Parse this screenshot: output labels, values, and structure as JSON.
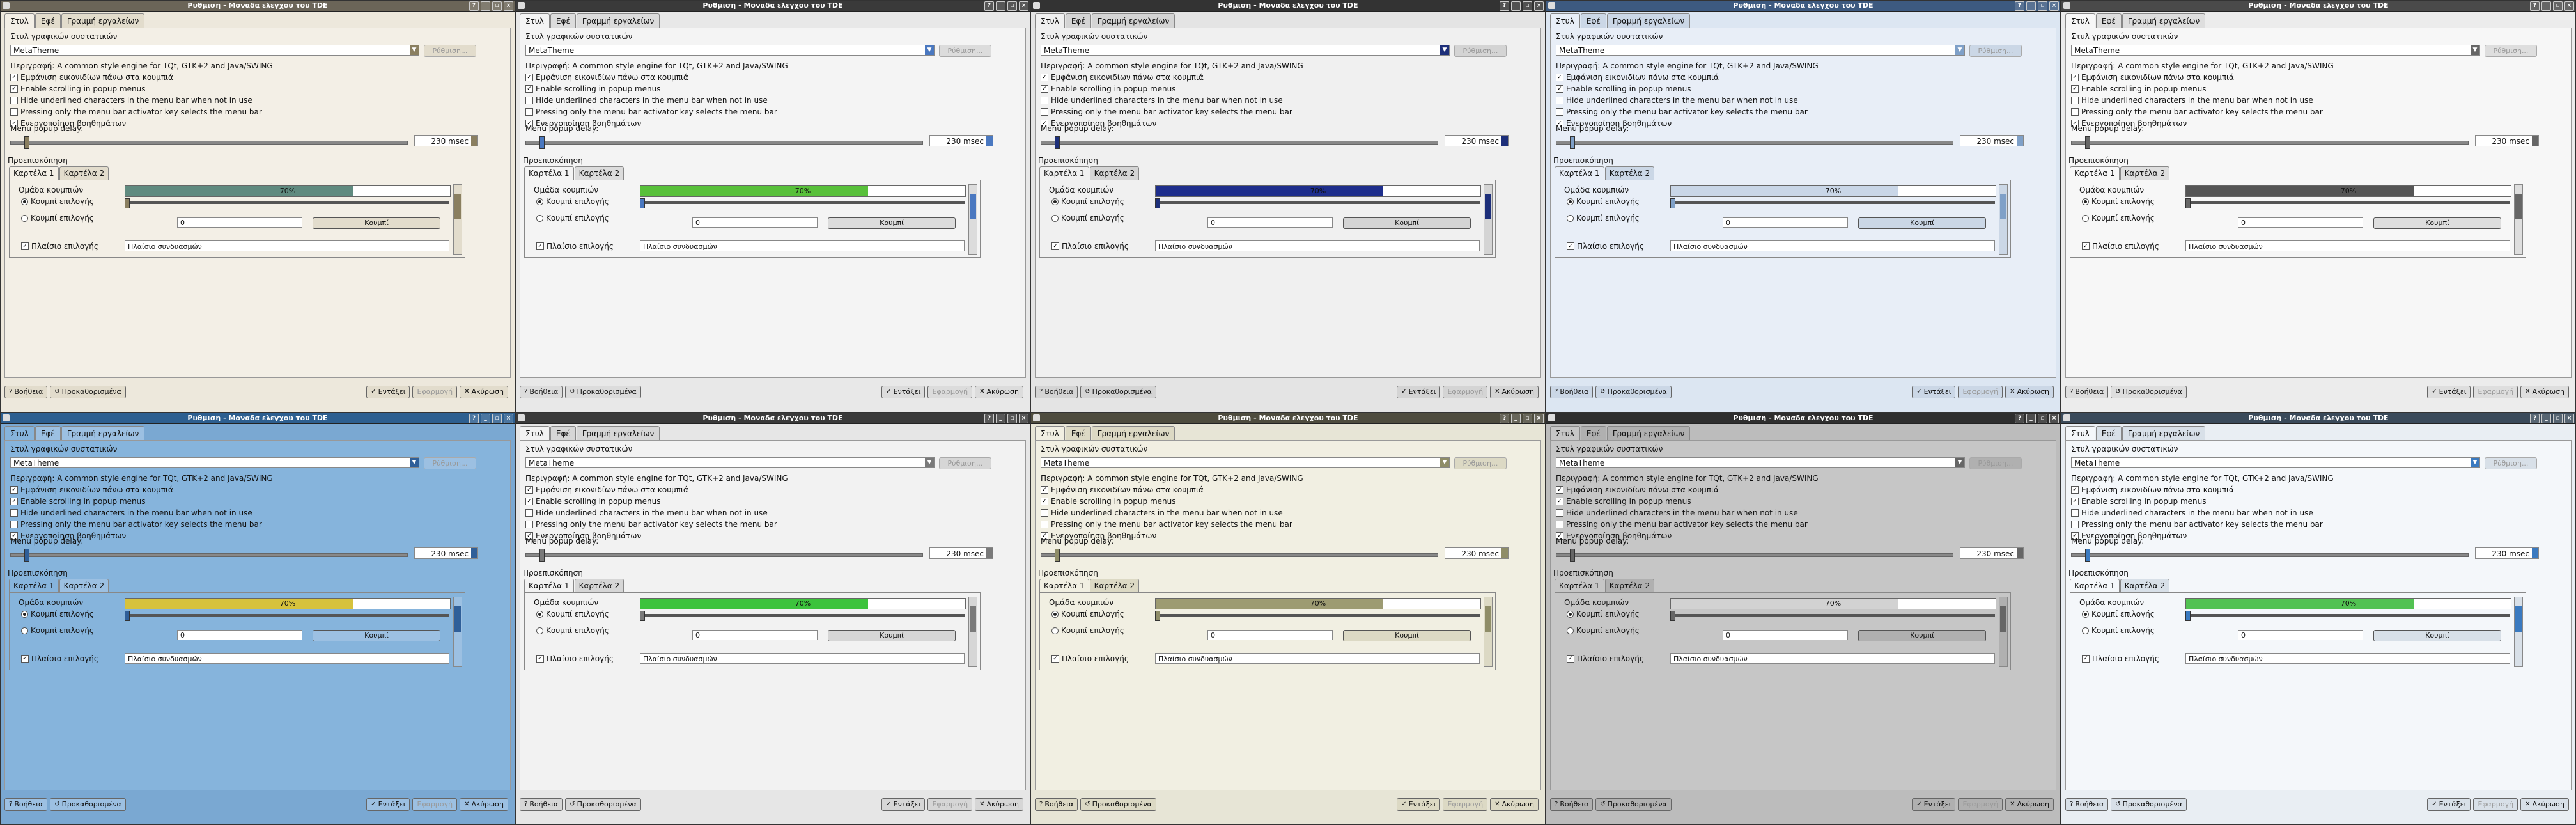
{
  "window_title": "Ρυθμιση - Μοναδα ελεγχου του TDE",
  "title_buttons": [
    "?",
    "_",
    "▫",
    "×"
  ],
  "main_tabs": [
    "Στυλ",
    "Εφέ",
    "Γραμμή εργαλείων"
  ],
  "style_section_label": "Στυλ γραφικών συστατικών",
  "style_combo_value": "MetaTheme",
  "configure_button": "Ρύθμιση...",
  "description": "Περιγραφή: A common style engine for TQt, GTK+2 and Java/SWING",
  "options": [
    "Εμφάνιση εικονιδίων πάνω στα κουμπιά",
    "Enable scrolling in popup menus",
    "Hide underlined characters in the menu bar when not in use",
    "Pressing only the menu bar activator key selects the menu bar",
    "Ενεργοποίηση βοηθημάτων"
  ],
  "menu_delay_label": "Menu popup delay:",
  "menu_delay_value": "230 msec",
  "preview_label": "Προεπισκόπηση",
  "preview_tabs": [
    "Καρτέλα 1",
    "Καρτέλα 2"
  ],
  "preview_group_label": "Ομάδα κουμπιών",
  "preview_radio_1": "Κουμπί επιλογής",
  "preview_radio_2": "Κουμπί επιλογής",
  "preview_progress_text": "70%",
  "preview_progress": 0.7,
  "preview_spin_value": "0",
  "preview_button": "Κουμπί",
  "preview_checkbox": "Πλαίσιο επιλογής",
  "preview_combo": "Πλαίσιο συνδυασμών",
  "bottom_buttons": {
    "help": "Βοήθεια",
    "defaults": "Προκαθορισμένα",
    "apply": "Εντάξει",
    "disabled": "Εφαρμογή",
    "cancel": "Ακύρωση"
  },
  "themes": [
    {
      "bg": "#ede8dc",
      "panel": "#f3efe6",
      "tabbg": "#e2dccc",
      "tb": "#6b6558",
      "accent": "#8a7f60",
      "prog": "#5f8a7f",
      "checked": [
        true,
        true,
        false,
        false,
        true
      ]
    },
    {
      "bg": "#e8e8e8",
      "panel": "#f4f4f4",
      "tabbg": "#dcdcdc",
      "tb": "#3a3a3a",
      "accent": "#4a78c0",
      "prog": "#58c03a",
      "checked": [
        true,
        true,
        false,
        false,
        true
      ]
    },
    {
      "bg": "#e4e4e4",
      "panel": "#f0f0f0",
      "tabbg": "#d4d4d4",
      "tb": "#333333",
      "accent": "#1d2f7a",
      "prog": "#1e2e8c",
      "checked": [
        true,
        true,
        false,
        false,
        true
      ]
    },
    {
      "bg": "#dce6f2",
      "panel": "#e8eef7",
      "tabbg": "#cbd7e6",
      "tb": "#3d5a80",
      "accent": "#7fa0c8",
      "prog": "#c9d6e7",
      "checked": [
        true,
        true,
        false,
        false,
        true
      ]
    },
    {
      "bg": "#ececec",
      "panel": "#f7f7f7",
      "tabbg": "#dedede",
      "tb": "#4a4a4a",
      "accent": "#666666",
      "prog": "#555555",
      "checked": [
        true,
        true,
        false,
        false,
        true
      ]
    },
    {
      "bg": "#7aa8d2",
      "panel": "#86b4dc",
      "tabbg": "#9cc0e2",
      "tb": "#2d5f90",
      "accent": "#2f5f99",
      "prog": "#d6c23c",
      "checked": [
        true,
        true,
        false,
        false,
        true
      ]
    },
    {
      "bg": "#e6e6e6",
      "panel": "#f2f2f2",
      "tabbg": "#d6d6d6",
      "tb": "#3a3a3a",
      "accent": "#7a7a7a",
      "prog": "#3cc33c",
      "checked": [
        true,
        true,
        false,
        false,
        true
      ]
    },
    {
      "bg": "#e7e5d6",
      "panel": "#f1efe2",
      "tabbg": "#dcd9c4",
      "tb": "#4e4c3e",
      "accent": "#8f8d68",
      "prog": "#9d9b72",
      "checked": [
        true,
        true,
        false,
        false,
        true
      ]
    },
    {
      "bg": "#bcbcbc",
      "panel": "#c6c6c6",
      "tabbg": "#b0b0b0",
      "tb": "#2e2e2e",
      "accent": "#666666",
      "prog": "#d2d2d2",
      "checked": [
        true,
        true,
        false,
        false,
        true
      ]
    },
    {
      "bg": "#e9eef3",
      "panel": "#f4f7fa",
      "tabbg": "#d8e0e8",
      "tb": "#3a4a5a",
      "accent": "#3a7ac0",
      "prog": "#52c252",
      "checked": [
        true,
        true,
        false,
        false,
        true
      ]
    }
  ]
}
